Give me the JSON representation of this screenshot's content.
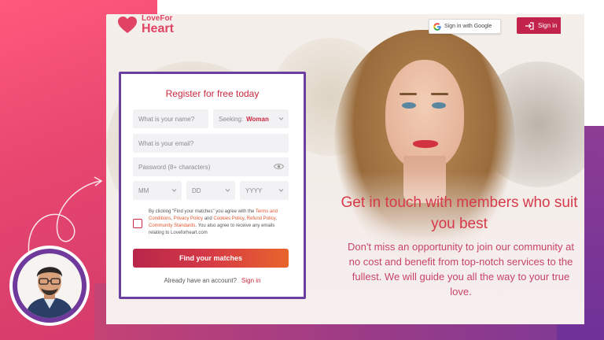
{
  "brand": {
    "line1": "LoveFor",
    "line2": "Heart"
  },
  "header": {
    "google_label": "Sign in with Google",
    "signin_label": "Sign in"
  },
  "form": {
    "title": "Register for free today",
    "name_placeholder": "What is your name?",
    "seeking_label": "Seeking:",
    "seeking_value": "Woman",
    "email_placeholder": "What is your email?",
    "password_placeholder": "Password (8+ characters)",
    "month_placeholder": "MM",
    "day_placeholder": "DD",
    "year_placeholder": "YYYY",
    "terms": {
      "part1": "By clicking \"Find your matches\" you agree with the ",
      "link1": "Terms and Conditions",
      "sep1": ", ",
      "link2": "Privacy Policy",
      "sep2": " and ",
      "link3": "Cookies Policy",
      "sep3": ", ",
      "link4": "Refund Policy",
      "sep4": ", ",
      "link5": "Community Standards",
      "part2": ". You also agree to receive any emails relating to Loveforheart.com"
    },
    "submit_label": "Find your matches",
    "account_text": "Already have an account?",
    "account_link": "Sign in"
  },
  "hero": {
    "headline": "Get in touch with members who suit you best",
    "subtext": "Don't miss an opportunity to join our community at no cost and benefit from top-notch services to the fullest. We will guide you all the way to your true love."
  },
  "colors": {
    "accent": "#c9283f",
    "brand_pink": "#e04363",
    "card_border": "#6a3fa0",
    "cta_start": "#b8264a",
    "cta_end": "#e8652c"
  }
}
